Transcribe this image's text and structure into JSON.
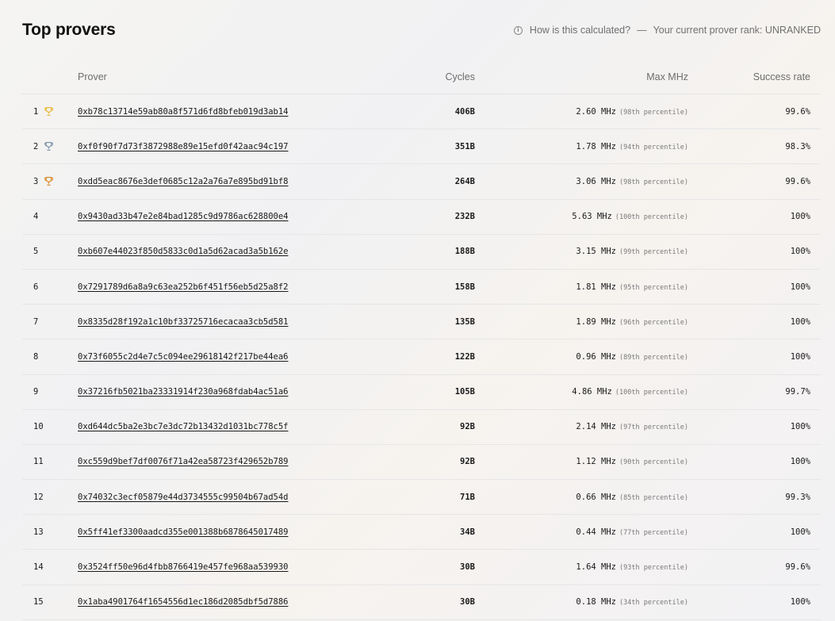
{
  "header": {
    "title": "Top provers",
    "hint_link": "How is this calculated?",
    "separator": "—",
    "rank_text": "Your current prover rank: UNRANKED"
  },
  "columns": {
    "prover": "Prover",
    "cycles": "Cycles",
    "max_mhz": "Max MHz",
    "success_rate": "Success rate"
  },
  "colors": {
    "gold": "#e8b93a",
    "silver": "#7f95a8",
    "bronze": "#d98a2f"
  },
  "rows": [
    {
      "rank": "1",
      "trophy": "gold",
      "address": "0xb78c13714e59ab80a8f571d6fd8bfeb019d3ab14",
      "cycles": "406B",
      "mhz": "2.60 MHz",
      "percentile": "(98th percentile)",
      "rate": "99.6%"
    },
    {
      "rank": "2",
      "trophy": "silver",
      "address": "0xf0f90f7d73f3872988e89e15efd0f42aac94c197",
      "cycles": "351B",
      "mhz": "1.78 MHz",
      "percentile": "(94th percentile)",
      "rate": "98.3%"
    },
    {
      "rank": "3",
      "trophy": "bronze",
      "address": "0xdd5eac8676e3def0685c12a2a76a7e895bd91bf8",
      "cycles": "264B",
      "mhz": "3.06 MHz",
      "percentile": "(98th percentile)",
      "rate": "99.6%"
    },
    {
      "rank": "4",
      "trophy": "",
      "address": "0x9430ad33b47e2e84bad1285c9d9786ac628800e4",
      "cycles": "232B",
      "mhz": "5.63 MHz",
      "percentile": "(100th percentile)",
      "rate": "100%"
    },
    {
      "rank": "5",
      "trophy": "",
      "address": "0xb607e44023f850d5833c0d1a5d62acad3a5b162e",
      "cycles": "188B",
      "mhz": "3.15 MHz",
      "percentile": "(99th percentile)",
      "rate": "100%"
    },
    {
      "rank": "6",
      "trophy": "",
      "address": "0x7291789d6a8a9c63ea252b6f451f56eb5d25a8f2",
      "cycles": "158B",
      "mhz": "1.81 MHz",
      "percentile": "(95th percentile)",
      "rate": "100%"
    },
    {
      "rank": "7",
      "trophy": "",
      "address": "0x8335d28f192a1c10bf33725716ecacaa3cb5d581",
      "cycles": "135B",
      "mhz": "1.89 MHz",
      "percentile": "(96th percentile)",
      "rate": "100%"
    },
    {
      "rank": "8",
      "trophy": "",
      "address": "0x73f6055c2d4e7c5c094ee29618142f217be44ea6",
      "cycles": "122B",
      "mhz": "0.96 MHz",
      "percentile": "(89th percentile)",
      "rate": "100%"
    },
    {
      "rank": "9",
      "trophy": "",
      "address": "0x37216fb5021ba23331914f230a968fdab4ac51a6",
      "cycles": "105B",
      "mhz": "4.86 MHz",
      "percentile": "(100th percentile)",
      "rate": "99.7%"
    },
    {
      "rank": "10",
      "trophy": "",
      "address": "0xd644dc5ba2e3bc7e3dc72b13432d1031bc778c5f",
      "cycles": "92B",
      "mhz": "2.14 MHz",
      "percentile": "(97th percentile)",
      "rate": "100%"
    },
    {
      "rank": "11",
      "trophy": "",
      "address": "0xc559d9bef7df0076f71a42ea58723f429652b789",
      "cycles": "92B",
      "mhz": "1.12 MHz",
      "percentile": "(90th percentile)",
      "rate": "100%"
    },
    {
      "rank": "12",
      "trophy": "",
      "address": "0x74032c3ecf05879e44d3734555c99504b67ad54d",
      "cycles": "71B",
      "mhz": "0.66 MHz",
      "percentile": "(85th percentile)",
      "rate": "99.3%"
    },
    {
      "rank": "13",
      "trophy": "",
      "address": "0x5ff41ef3300aadcd355e001388b6878645017489",
      "cycles": "34B",
      "mhz": "0.44 MHz",
      "percentile": "(77th percentile)",
      "rate": "100%"
    },
    {
      "rank": "14",
      "trophy": "",
      "address": "0x3524ff50e96d4fbb8766419e457fe968aa539930",
      "cycles": "30B",
      "mhz": "1.64 MHz",
      "percentile": "(93th percentile)",
      "rate": "99.6%"
    },
    {
      "rank": "15",
      "trophy": "",
      "address": "0x1aba4901764f1654556d1ec186d2085dbf5d7886",
      "cycles": "30B",
      "mhz": "0.18 MHz",
      "percentile": "(34th percentile)",
      "rate": "100%"
    }
  ]
}
